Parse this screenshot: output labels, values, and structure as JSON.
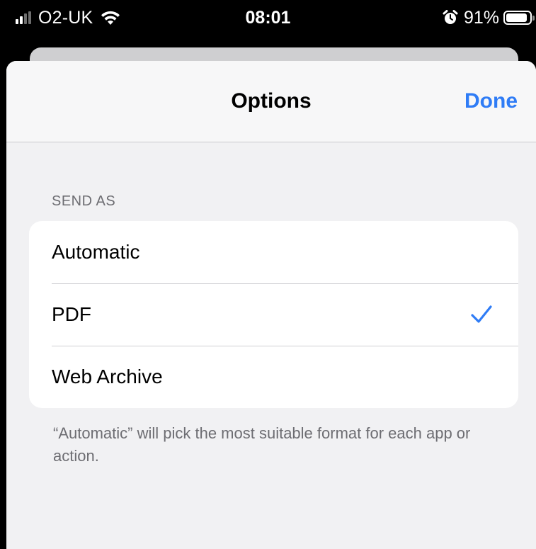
{
  "status_bar": {
    "carrier": "O2-UK",
    "time": "08:01",
    "battery_percent": "91%",
    "battery_level": 0.91,
    "icons": [
      "signal-icon",
      "wifi-icon",
      "alarm-icon",
      "battery-icon"
    ]
  },
  "sheet": {
    "title": "Options",
    "done_label": "Done",
    "section_header": "SEND AS",
    "options": [
      {
        "label": "Automatic",
        "selected": false
      },
      {
        "label": "PDF",
        "selected": true
      },
      {
        "label": "Web Archive",
        "selected": false
      }
    ],
    "footer_note": "“Automatic” will pick the most suitable format for each app or action."
  },
  "colors": {
    "accent": "#2f7cf6",
    "sheet_background": "#f1f1f3",
    "secondary_text": "#6d6d72"
  }
}
